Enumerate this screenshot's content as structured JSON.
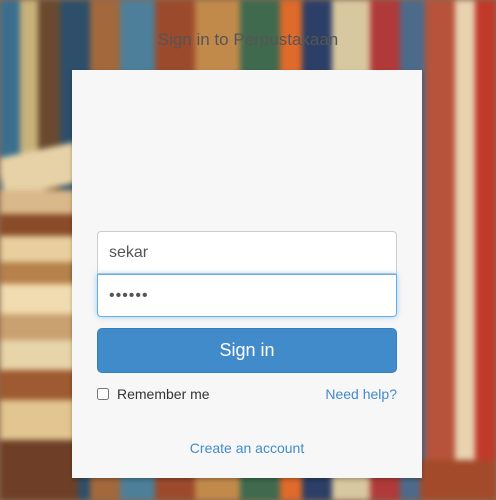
{
  "page": {
    "title": "Sign in to Perpustakaan"
  },
  "form": {
    "username_value": "sekar",
    "password_value": "••••••",
    "signin_label": "Sign in",
    "remember_label": "Remember me",
    "remember_checked": false,
    "help_label": "Need help?",
    "create_account_label": "Create an account"
  },
  "colors": {
    "accent": "#428bca",
    "card_background": "#f7f7f7",
    "focus_border": "#66afe9"
  },
  "background": {
    "description_icon": "books-photo"
  }
}
